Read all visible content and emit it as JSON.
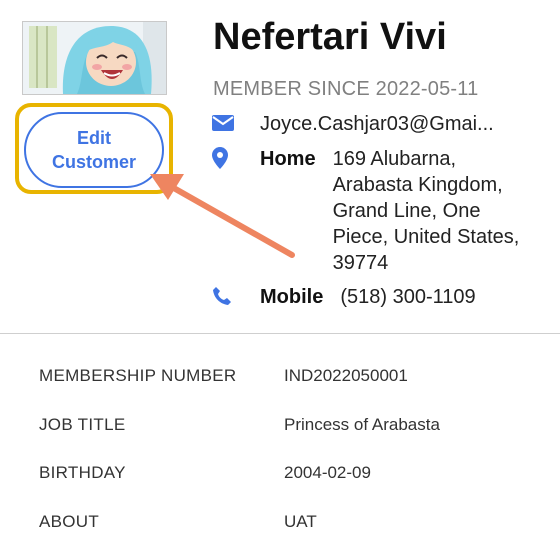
{
  "profile": {
    "name": "Nefertari Vivi",
    "member_since": "MEMBER SINCE 2022-05-11",
    "edit_button": "Edit\nCustomer",
    "email": "Joyce.Cashjar03@Gmai...",
    "address_label": "Home",
    "address": "169 Alubarna, Arabasta Kingdom, Grand Line, One Piece, United States, 39774",
    "phone_label": "Mobile",
    "phone": "(518) 300-1109"
  },
  "details": [
    {
      "label": "MEMBERSHIP NUMBER",
      "value": "IND2022050001"
    },
    {
      "label": "JOB TITLE",
      "value": "Princess of Arabasta"
    },
    {
      "label": "BIRTHDAY",
      "value": "2004-02-09"
    },
    {
      "label": "ABOUT",
      "value": "UAT"
    }
  ],
  "colors": {
    "accent": "#3f74e3",
    "highlight": "#e8b400",
    "arrow": "#ee8560"
  },
  "icons": {
    "email": "envelope-icon",
    "address": "map-pin-icon",
    "phone": "phone-icon"
  }
}
